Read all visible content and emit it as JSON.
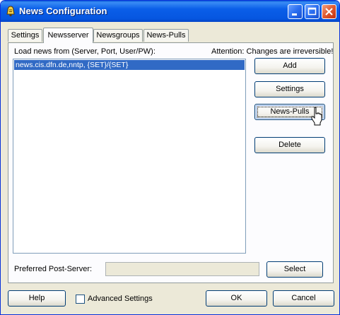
{
  "window": {
    "title": "News Configuration",
    "icon": "app-bell-icon"
  },
  "titlebar_buttons": [
    "minimize-icon",
    "maximize-icon",
    "close-icon"
  ],
  "tabs": [
    {
      "label": "Settings",
      "active": false
    },
    {
      "label": "Newsserver",
      "active": true
    },
    {
      "label": "Newsgroups",
      "active": false
    },
    {
      "label": "News-Pulls",
      "active": false
    }
  ],
  "panel": {
    "list_label": "Load news from (Server, Port, User/PW):",
    "attention": "Attention: Changes are irreversible!",
    "servers": [
      {
        "text": "news.cis.dfn.de,nntp, {SET}/{SET}",
        "selected": true
      }
    ],
    "buttons": {
      "add": "Add",
      "settings": "Settings",
      "news_pulls": "News-Pulls",
      "delete": "Delete",
      "select": "Select"
    },
    "post_server_label": "Preferred Post-Server:",
    "post_server_value": ""
  },
  "footer": {
    "help": "Help",
    "advanced_settings": "Advanced Settings",
    "advanced_checked": false,
    "ok": "OK",
    "cancel": "Cancel"
  },
  "colors": {
    "titlebar": "#0a5ee8",
    "selection": "#316ac5",
    "dialog_bg": "#ece9d8"
  }
}
